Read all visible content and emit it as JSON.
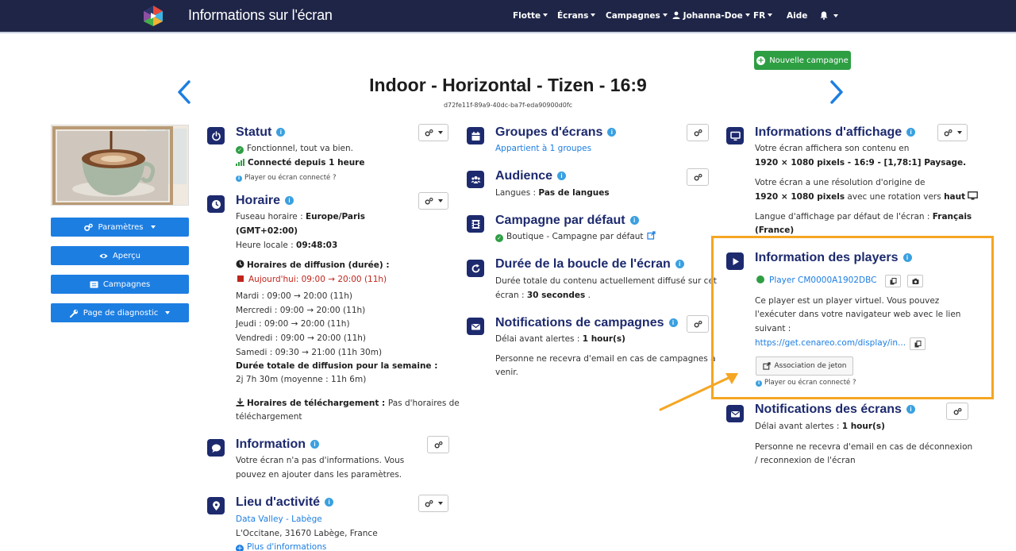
{
  "nav": {
    "app_title": "Informations sur l'écran",
    "items": [
      "Flotte",
      "Écrans",
      "Campagnes",
      "Johanna-Doe",
      "FR",
      "Aide"
    ]
  },
  "header": {
    "new_campaign": "Nouvelle campagne",
    "title": "Indoor - Horizontal - Tizen - 16:9",
    "screen_id": "d72fe11f-89a9-40dc-ba7f-eda90900d0fc"
  },
  "sidebar": {
    "buttons": [
      "Paramètres",
      "Aperçu",
      "Campagnes",
      "Page de diagnostic"
    ]
  },
  "statut": {
    "title": "Statut",
    "status": "Fonctionnel, tout va bien.",
    "connected": "Connecté depuis 1 heure",
    "help": "Player ou écran connecté ?"
  },
  "horaire": {
    "title": "Horaire",
    "tz_label": "Fuseau horaire : ",
    "tz_value": "Europe/Paris",
    "tz_offset": "(GMT+02:00)",
    "local_label": "Heure locale : ",
    "local_value": "09:48:03",
    "diffusion_title": "Horaires de diffusion (durée) :",
    "today": "Aujourd'hui: 09:00 → 20:00 (11h)",
    "days": [
      "Mardi : 09:00 → 20:00 (11h)",
      "Mercredi : 09:00 → 20:00 (11h)",
      "Jeudi : 09:00 → 20:00 (11h)",
      "Vendredi : 09:00 → 20:00 (11h)",
      "Samedi : 09:30 → 21:00 (11h 30m)"
    ],
    "total_title": "Durée totale de diffusion pour la semaine :",
    "total_value": "2j 7h 30m (moyenne : 11h 6m)",
    "download_label": "Horaires de téléchargement : ",
    "download_value_1": "Pas d'horaires de",
    "download_value_2": "téléchargement"
  },
  "information": {
    "title": "Information",
    "line1": "Votre écran n'a pas d'informations. Vous",
    "line2": "pouvez en ajouter dans les paramètres."
  },
  "lieu": {
    "title": "Lieu d'activité",
    "name": "Data Valley - Labège",
    "address": "L'Occitane, 31670 Labège, France",
    "more": "Plus d'informations"
  },
  "groupes": {
    "title": "Groupes d'écrans",
    "value": "Appartient à 1 groupes"
  },
  "audience": {
    "title": "Audience",
    "label": "Langues : ",
    "value": "Pas de langues"
  },
  "campagne_defaut": {
    "title": "Campagne par défaut",
    "value": "Boutique - Campagne par défaut"
  },
  "boucle": {
    "title": "Durée de la boucle de l'écran",
    "line1": "Durée totale du contenu actuellement diffusé sur cet",
    "line2_prefix": "écran : ",
    "line2_value": "30 secondes",
    "line2_suffix": " ."
  },
  "notif_campagnes": {
    "title": "Notifications de campagnes",
    "delay_label": "Délai avant alertes : ",
    "delay_value": "1 hour(s)",
    "line1": "Personne ne recevra d'email en cas de campagnes à",
    "line2": "venir."
  },
  "affichage": {
    "title": "Informations d'affichage",
    "line1": "Votre écran affichera son contenu en",
    "line2": "1920 × 1080 pixels - 16:9 - [1,78:1] Paysage.",
    "line3": "Votre écran a une résolution d'origine de",
    "line4_value": "1920  × 1080 pixels",
    "line4_mid": " avec une rotation vers ",
    "line4_dir": "haut",
    "line5_label": "Langue d'affichage par défaut de l'écran : ",
    "line5_value": "Français",
    "line6": "(France)"
  },
  "players": {
    "title": "Information des players",
    "player_name": "Player CM0000A1902DBC",
    "line1": "Ce player est un player virtuel. Vous pouvez",
    "line2": "l'exécuter dans votre navigateur web avec le lien",
    "line3": "suivant :",
    "url": "https://get.cenareo.com/display/in...",
    "token_button": "Association de jeton",
    "help": "Player ou écran connecté ?"
  },
  "notif_ecrans": {
    "title": "Notifications des écrans",
    "delay_label": "Délai avant alertes : ",
    "delay_value": "1 hour(s)",
    "line1": "Personne ne recevra d'email en cas de déconnexion",
    "line2": "/ reconnexion de l'écran"
  }
}
